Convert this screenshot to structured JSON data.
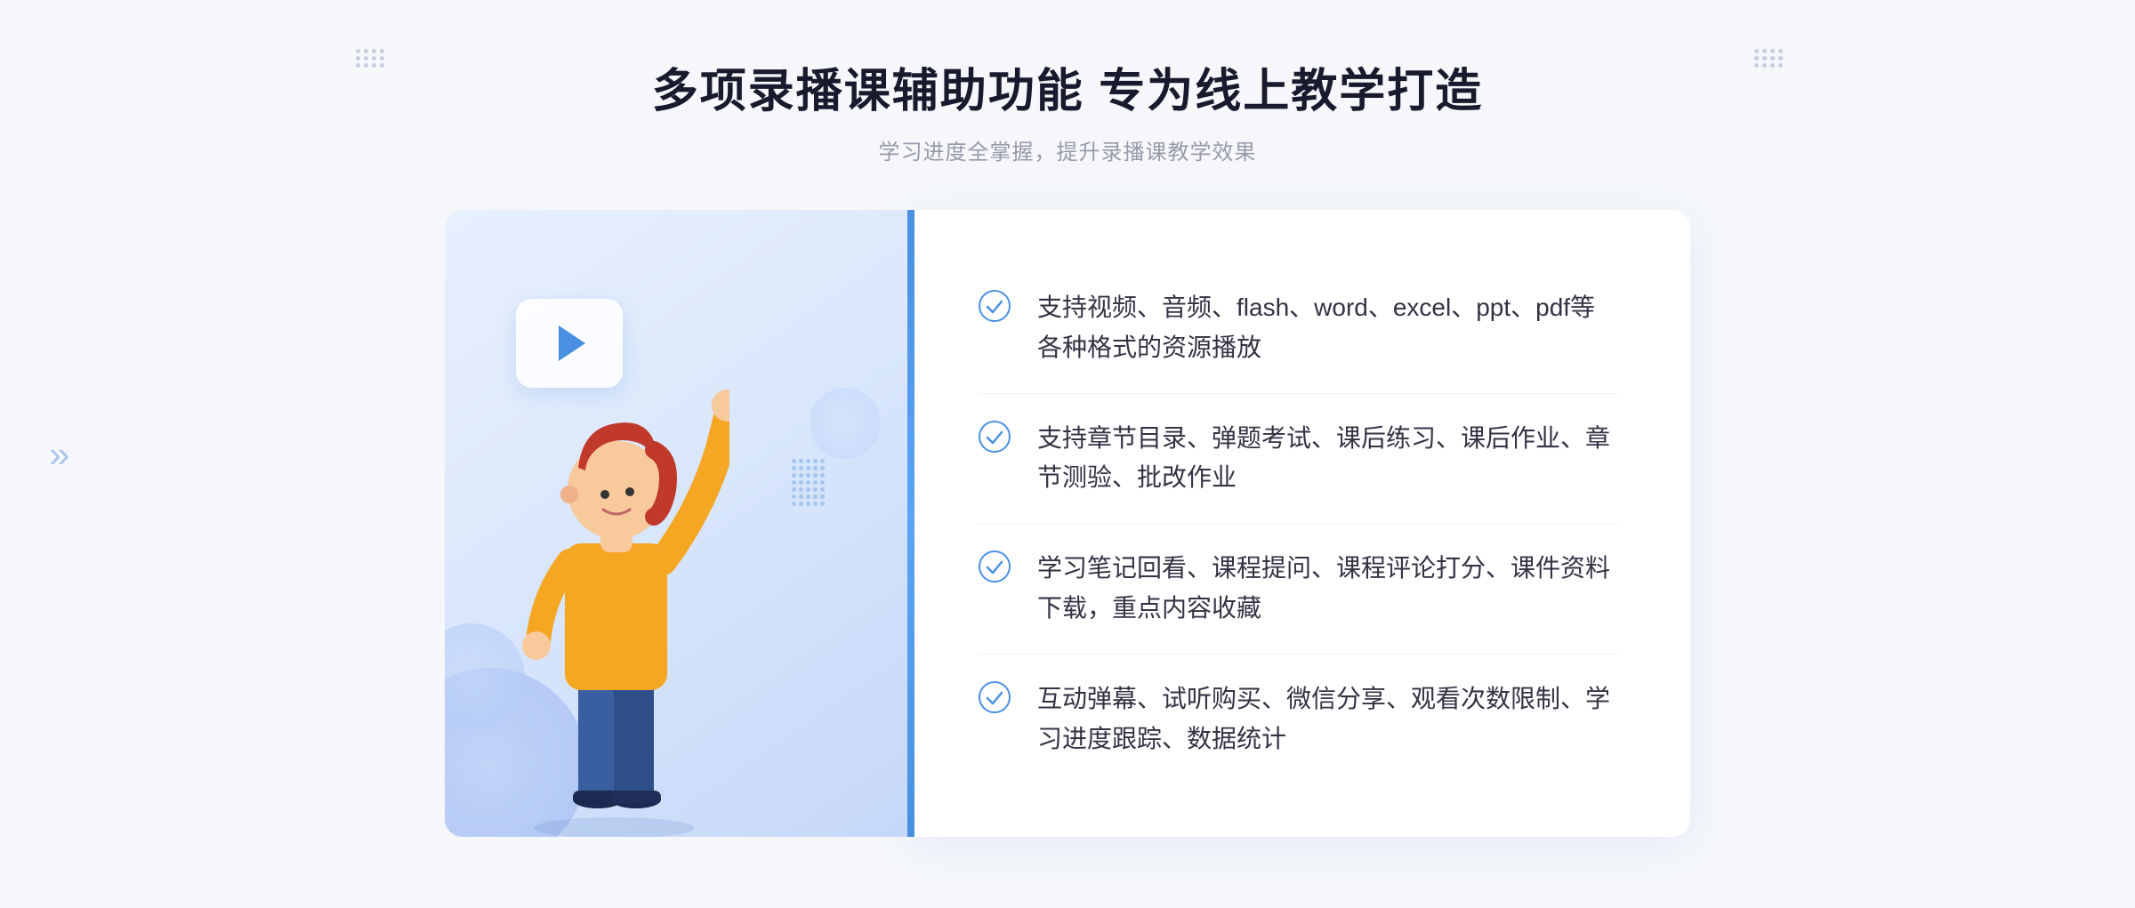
{
  "header": {
    "title": "多项录播课辅助功能 专为线上教学打造",
    "subtitle": "学习进度全掌握，提升录播课教学效果",
    "dots_decoration": "≋"
  },
  "features": [
    {
      "id": "feature-1",
      "text": "支持视频、音频、flash、word、excel、ppt、pdf等各种格式的资源播放"
    },
    {
      "id": "feature-2",
      "text": "支持章节目录、弹题考试、课后练习、课后作业、章节测验、批改作业"
    },
    {
      "id": "feature-3",
      "text": "学习笔记回看、课程提问、课程评论打分、课件资料下载，重点内容收藏"
    },
    {
      "id": "feature-4",
      "text": "互动弹幕、试听购买、微信分享、观看次数限制、学习进度跟踪、数据统计"
    }
  ],
  "illustration": {
    "play_button_label": "▶",
    "left_arrow": "»"
  },
  "colors": {
    "accent_blue": "#4a90e2",
    "light_blue_bg": "#dce8fc",
    "title_color": "#1a1a2e",
    "text_color": "#333344",
    "subtitle_color": "#999aaa",
    "check_color": "#4a90e2"
  }
}
